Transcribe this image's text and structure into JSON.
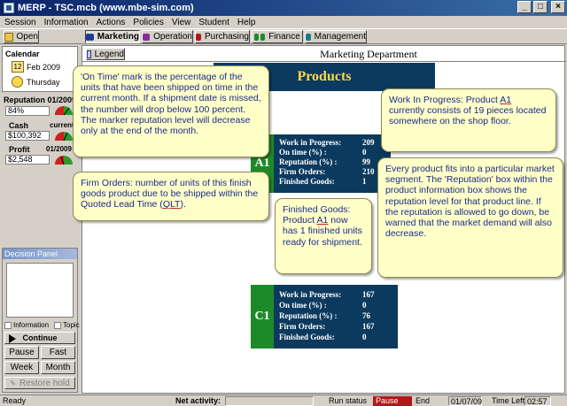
{
  "window": {
    "title": "MERP - TSC.mcb (www.mbe-sim.com)",
    "controls": {
      "minimize": "_",
      "maximize": "□",
      "close": "×"
    }
  },
  "menu": [
    "Session",
    "Information",
    "Actions",
    "Policies",
    "View",
    "Student",
    "Help"
  ],
  "toolbar": {
    "open": "Open",
    "tabs": [
      {
        "label": "Marketing",
        "icon": "binoculars-blue-icon",
        "active": true
      },
      {
        "label": "Operation",
        "icon": "binoculars-purple-icon"
      },
      {
        "label": "Purchasing",
        "icon": "binoculars-red-icon"
      },
      {
        "label": "Finance",
        "icon": "binoculars-green-icon"
      },
      {
        "label": "Management",
        "icon": "binoculars-teal-icon"
      }
    ]
  },
  "sidebar": {
    "calendar_label": "Calendar",
    "calendar_day": "12",
    "date": "Feb 2009",
    "weekday": "Thursday",
    "reputation_label": "Reputation 01/2009",
    "reputation_value": "84%",
    "cash_label": "Cash",
    "cash_sub": "current",
    "cash_value": "$100,392",
    "profit_label": "Profit",
    "profit_sub": "01/2009",
    "profit_value": "$2,548"
  },
  "main": {
    "legend": "Legend",
    "department": "Marketing Department",
    "products_title": "Products",
    "row_labels": [
      "Work in Progress:",
      "On time (%) :",
      "Reputation (%) :",
      "Firm Orders:",
      "Finished Goods:"
    ],
    "products": [
      {
        "id": "A1",
        "values": [
          "209",
          "0",
          "99",
          "210",
          "1"
        ]
      },
      {
        "id": "C1",
        "values": [
          "167",
          "0",
          "76",
          "167",
          "0"
        ]
      }
    ]
  },
  "callouts": {
    "ontime": "'On Time' mark is the percentage of the units that have been shipped on time in the current month. If a shipment date is missed, the number will drop below 100 percent. The marker reputation level will decrease only at the end of the month.",
    "wip_a": "Work In Progress: Product ",
    "wip_prod": "A1",
    "wip_b": " currently consists of 19 pieces located somewhere on the shop floor.",
    "firm_a": "Firm Orders: number of units of this finish goods product due to be shipped within the Quoted Lead Time (",
    "firm_qlt": "QLT",
    "firm_b": ").",
    "fg_a": "Finished Goods: Product ",
    "fg_prod": "A1",
    "fg_b": " now has 1 finished units ready for shipment.",
    "segment": "Every product fits into a particular market segment. The 'Reputation' box within the product information box shows the reputation level for that product line. If the reputation is allowed to go down, be warned that the market demand will also decrease."
  },
  "decision_panel": {
    "title": "Decision Panel",
    "information": "Information",
    "topic": "Topic",
    "continue": "Continue",
    "pause": "Pause",
    "fast": "Fast",
    "week": "Week",
    "month": "Month",
    "restore": "Restore hold"
  },
  "status": {
    "ready": "Ready",
    "net_activity": "Net activity:",
    "run_status_label": "Run status",
    "run_status": "Pause",
    "end_label": "End",
    "end_date": "01/07/09",
    "time_left_label": "Time Left",
    "time_left": "02:57"
  },
  "colors": {
    "product_box": "#0b3a5e",
    "product_tag": "#1d8a2a",
    "callout_bg": "#ffffc8",
    "callout_text": "#1b2a8a",
    "pause_status": "#b01818"
  }
}
